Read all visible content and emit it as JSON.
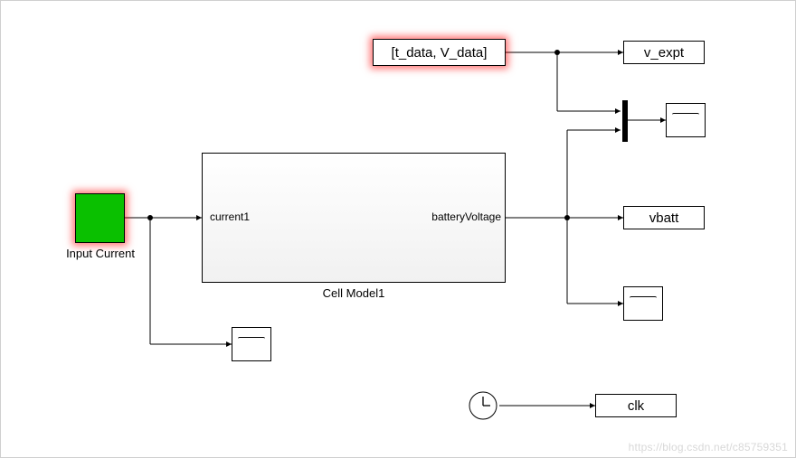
{
  "blocks": {
    "input_current": {
      "label": "Input Current"
    },
    "from_ws": {
      "text": "[t_data, V_data]"
    },
    "cell_model": {
      "label": "Cell Model1",
      "ports": {
        "in1": "current1",
        "out1": "batteryVoltage"
      }
    },
    "out_vexpt": {
      "text": "v_expt"
    },
    "out_vbatt": {
      "text": "vbatt"
    },
    "out_clk": {
      "text": "clk"
    }
  },
  "watermark": "https://blog.csdn.net/c85759351"
}
